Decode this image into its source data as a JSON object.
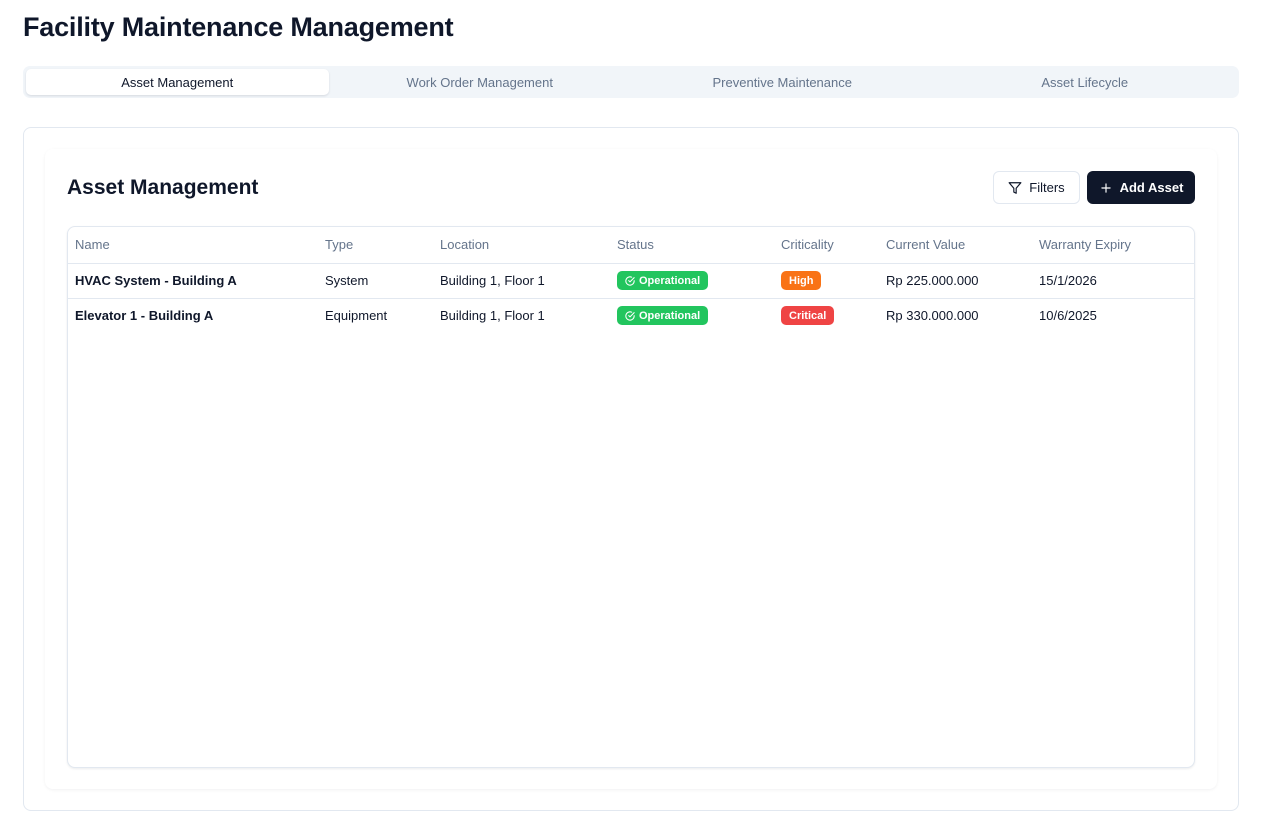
{
  "app": {
    "title": "Facility Maintenance Management"
  },
  "tabs": [
    {
      "label": "Asset Management",
      "active": true
    },
    {
      "label": "Work Order Management",
      "active": false
    },
    {
      "label": "Preventive Maintenance",
      "active": false
    },
    {
      "label": "Asset Lifecycle",
      "active": false
    }
  ],
  "section": {
    "title": "Asset Management",
    "filters_label": "Filters",
    "add_label": "Add Asset"
  },
  "table": {
    "columns": [
      "Name",
      "Type",
      "Location",
      "Status",
      "Criticality",
      "Current Value",
      "Warranty Expiry"
    ],
    "rows": [
      {
        "name": "HVAC System - Building A",
        "type": "System",
        "location": "Building 1, Floor 1",
        "status": "Operational",
        "criticality": "High",
        "value": "Rp 225.000.000",
        "warranty": "15/1/2026"
      },
      {
        "name": "Elevator 1 - Building A",
        "type": "Equipment",
        "location": "Building 1, Floor 1",
        "status": "Operational",
        "criticality": "Critical",
        "value": "Rp 330.000.000",
        "warranty": "10/6/2025"
      }
    ]
  },
  "colors": {
    "status_operational": "#22c55e",
    "criticality_high": "#f97316",
    "criticality_critical": "#ef4444",
    "primary": "#0f172a"
  },
  "icons": {
    "filters": "filter-funnel-icon",
    "add": "plus-icon",
    "status": "check-circle-icon"
  }
}
